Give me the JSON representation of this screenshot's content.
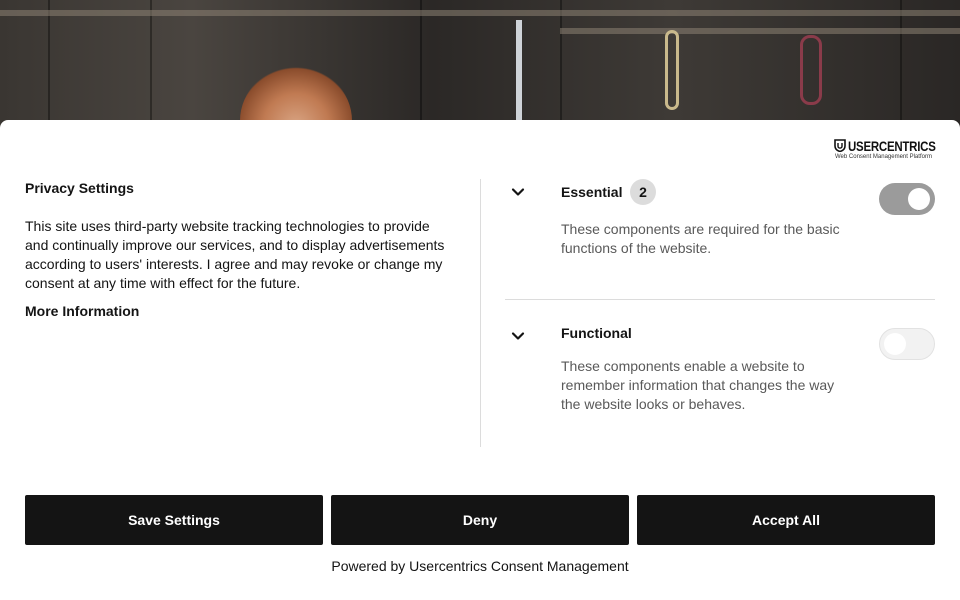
{
  "logo": {
    "name": "USERCENTRICS",
    "tagline": "Web Consent Management Platform"
  },
  "privacy": {
    "title": "Privacy Settings",
    "description": "This site uses third-party website tracking technologies to provide and continually improve our services, and to display advertisements according to users' interests. I agree and may revoke or change my consent at any time with effect for the future.",
    "more_info": "More Information"
  },
  "categories": [
    {
      "name": "Essential",
      "count": "2",
      "description": "These components are required for the basic functions of the website.",
      "enabled": true,
      "locked": true
    },
    {
      "name": "Functional",
      "description": "These components enable a website to remember information that changes the way the website looks or behaves.",
      "enabled": false
    }
  ],
  "buttons": {
    "save": "Save Settings",
    "deny": "Deny",
    "accept": "Accept All"
  },
  "footer": {
    "powered_by": "Powered by Usercentrics Consent Management"
  },
  "colors": {
    "button_bg": "#141414",
    "button_text": "#ffffff",
    "toggle_on": "#9b9b9b",
    "toggle_off": "#f2f2f2"
  }
}
